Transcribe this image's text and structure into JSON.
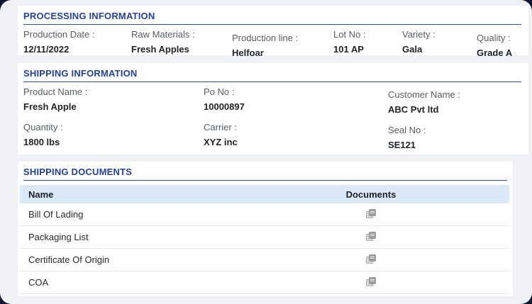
{
  "colors": {
    "frame_navy": "#10152f",
    "page_bg": "#f0f1f5",
    "section_title_blue": "#24419a",
    "table_header_bg": "#dbe9f9",
    "label_gray": "#585d64",
    "value_dark": "#1f2227"
  },
  "processing": {
    "title": "PROCESSING INFORMATION",
    "fields": [
      {
        "label": "Production Date :",
        "value": "12/11/2022"
      },
      {
        "label": "Raw Materials :",
        "value": "Fresh Apples"
      },
      {
        "label": "Production line :",
        "value": "Helfoar"
      },
      {
        "label": "Lot No :",
        "value": "101 AP"
      },
      {
        "label": "Variety :",
        "value": "Gala"
      },
      {
        "label": "Quality :",
        "value": "Grade A"
      }
    ]
  },
  "shipping": {
    "title": "SHIPPING INFORMATION",
    "fields": [
      {
        "label": "Product Name :",
        "value": "Fresh Apple"
      },
      {
        "label": "Po No :",
        "value": "10000897"
      },
      {
        "label": "Customer Name :",
        "value": "ABC Pvt ltd"
      },
      {
        "label": "Quantity :",
        "value": "1800 lbs"
      },
      {
        "label": "Carrier :",
        "value": "XYZ inc"
      },
      {
        "label": "Seal No :",
        "value": "SE121"
      }
    ]
  },
  "documents": {
    "title": "SHIPPING DOCUMENTS",
    "columns": {
      "name": "Name",
      "documents": "Documents"
    },
    "rows": [
      {
        "name": "Bill Of Lading"
      },
      {
        "name": "Packaging List"
      },
      {
        "name": "Certificate Of Origin"
      },
      {
        "name": "COA"
      }
    ],
    "icon": "document-file-icon"
  }
}
